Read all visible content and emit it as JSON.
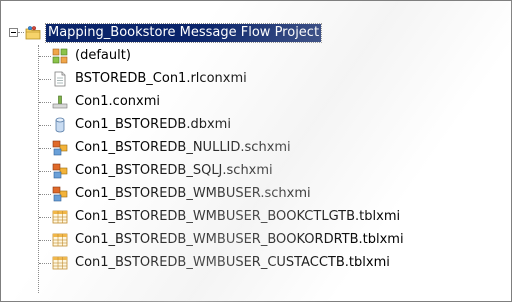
{
  "tree": {
    "root": {
      "label": "Mapping_Bookstore Message Flow Project",
      "icon": "project-folder-icon"
    },
    "children": [
      {
        "label": "(default)",
        "icon": "package-icon"
      },
      {
        "label": "BSTOREDB_Con1.rlconxmi",
        "icon": "file-icon"
      },
      {
        "label": "Con1.conxmi",
        "icon": "connection-icon"
      },
      {
        "label": "Con1_BSTOREDB.dbxmi",
        "icon": "database-icon"
      },
      {
        "label": "Con1_BSTOREDB_NULLID.schxmi",
        "icon": "schema-icon"
      },
      {
        "label": "Con1_BSTOREDB_SQLJ.schxmi",
        "icon": "schema-icon"
      },
      {
        "label": "Con1_BSTOREDB_WMBUSER.schxmi",
        "icon": "schema-icon"
      },
      {
        "label": "Con1_BSTOREDB_WMBUSER_BOOKCTLGTB.tblxmi",
        "icon": "table-icon"
      },
      {
        "label": "Con1_BSTOREDB_WMBUSER_BOOKORDRTB.tblxmi",
        "icon": "table-icon"
      },
      {
        "label": "Con1_BSTOREDB_WMBUSER_CUSTACCTB.tblxmi",
        "icon": "table-icon"
      }
    ]
  },
  "colors": {
    "selection": "#0a246a",
    "tree_line": "#8a8a8a"
  }
}
